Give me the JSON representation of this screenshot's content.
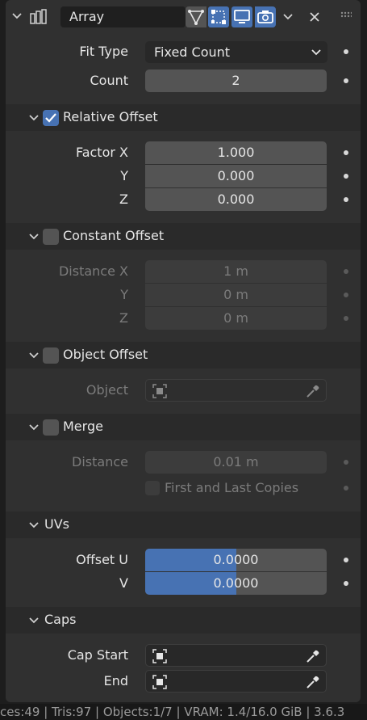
{
  "header": {
    "modifier_name": "Array",
    "icons": [
      "array-modifier-icon",
      "edit-mode-icon",
      "on-cage-icon",
      "realtime-display-icon",
      "render-icon",
      "dropdown-arrow-icon",
      "close-icon",
      "drag-handle-icon"
    ]
  },
  "top": {
    "fit_type_label": "Fit Type",
    "fit_type_value": "Fixed Count",
    "count_label": "Count",
    "count_value": "2"
  },
  "relative_offset": {
    "title": "Relative Offset",
    "checked": true,
    "factor_x_label": "Factor X",
    "factor_x": "1.000",
    "y_label": "Y",
    "y": "0.000",
    "z_label": "Z",
    "z": "0.000"
  },
  "constant_offset": {
    "title": "Constant Offset",
    "checked": false,
    "distance_x_label": "Distance X",
    "distance_x": "1 m",
    "y_label": "Y",
    "y": "0 m",
    "z_label": "Z",
    "z": "0 m"
  },
  "object_offset": {
    "title": "Object Offset",
    "checked": false,
    "object_label": "Object"
  },
  "merge": {
    "title": "Merge",
    "checked": false,
    "distance_label": "Distance",
    "distance": "0.01 m",
    "first_last_label": "First and Last Copies"
  },
  "uvs": {
    "title": "UVs",
    "offset_u_label": "Offset U",
    "offset_u": "0.0000",
    "offset_u_fill": 0.5,
    "v_label": "V",
    "v": "0.0000",
    "v_fill": 0.5
  },
  "caps": {
    "title": "Caps",
    "cap_start_label": "Cap Start",
    "end_label": "End"
  },
  "status_bar": {
    "text": "ces:49 | Tris:97 | Objects:1/7 | VRAM: 1.4/16.0 GiB | 3.6.3"
  },
  "colors": {
    "accent": "#4772b3",
    "panel": "#303030",
    "field": "#545454",
    "section_header": "#2a2a2a"
  }
}
